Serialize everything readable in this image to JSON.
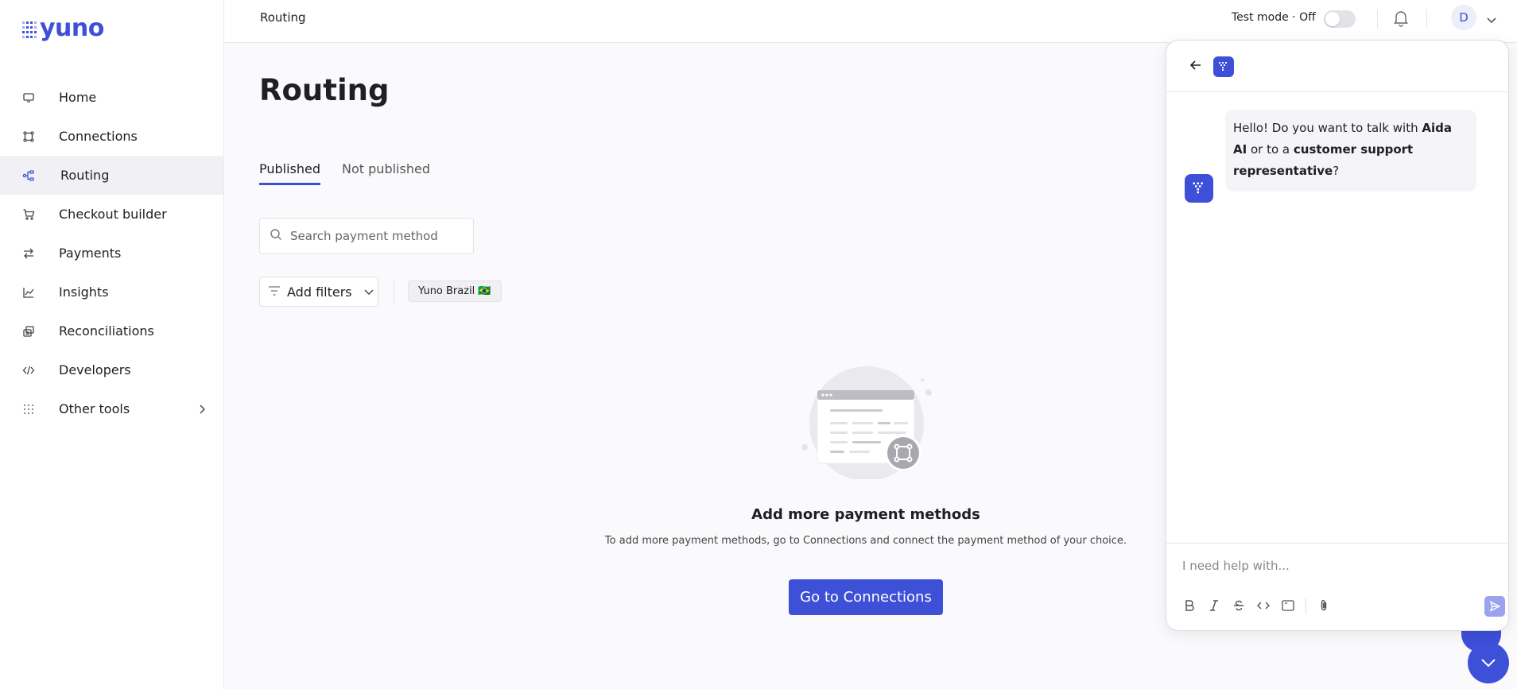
{
  "app": {
    "logo_text": "yuno",
    "accent": "#3e4fd8"
  },
  "sidebar": {
    "items": [
      {
        "label": "Home",
        "icon": "monitor-icon",
        "active": false
      },
      {
        "label": "Connections",
        "icon": "connections-icon",
        "active": false
      },
      {
        "label": "Routing",
        "icon": "routing-icon",
        "active": true
      },
      {
        "label": "Checkout builder",
        "icon": "cart-icon",
        "active": false
      },
      {
        "label": "Payments",
        "icon": "transfer-arrows-icon",
        "active": false
      },
      {
        "label": "Insights",
        "icon": "chart-icon",
        "active": false
      },
      {
        "label": "Reconciliations",
        "icon": "reconcile-icon",
        "active": false
      },
      {
        "label": "Developers",
        "icon": "code-icon",
        "active": false
      },
      {
        "label": "Other tools",
        "icon": "grid-dots-icon",
        "active": false
      }
    ]
  },
  "topbar": {
    "breadcrumb": "Routing",
    "test_mode_label": "Test mode · Off",
    "avatar_initial": "D"
  },
  "main": {
    "title": "Routing",
    "tabs": [
      {
        "label": "Published",
        "active": true
      },
      {
        "label": "Not published",
        "active": false
      }
    ],
    "search": {
      "placeholder": "Search payment method",
      "value": ""
    },
    "filters_label": "Add filters",
    "account_chip": "Yuno Brazil 🇧🇷",
    "empty_state": {
      "title": "Add more payment methods",
      "subtitle": "To add more payment methods, go to Connections and connect the payment method of your choice.",
      "cta_label": "Go to Connections"
    }
  },
  "chat": {
    "message_parts": {
      "p1": "Hello! Do you want to talk with ",
      "b1": "Aida AI",
      "p2": " or to a ",
      "b2": "customer support representative",
      "p3": "?"
    },
    "input_placeholder": "I need help with..."
  }
}
